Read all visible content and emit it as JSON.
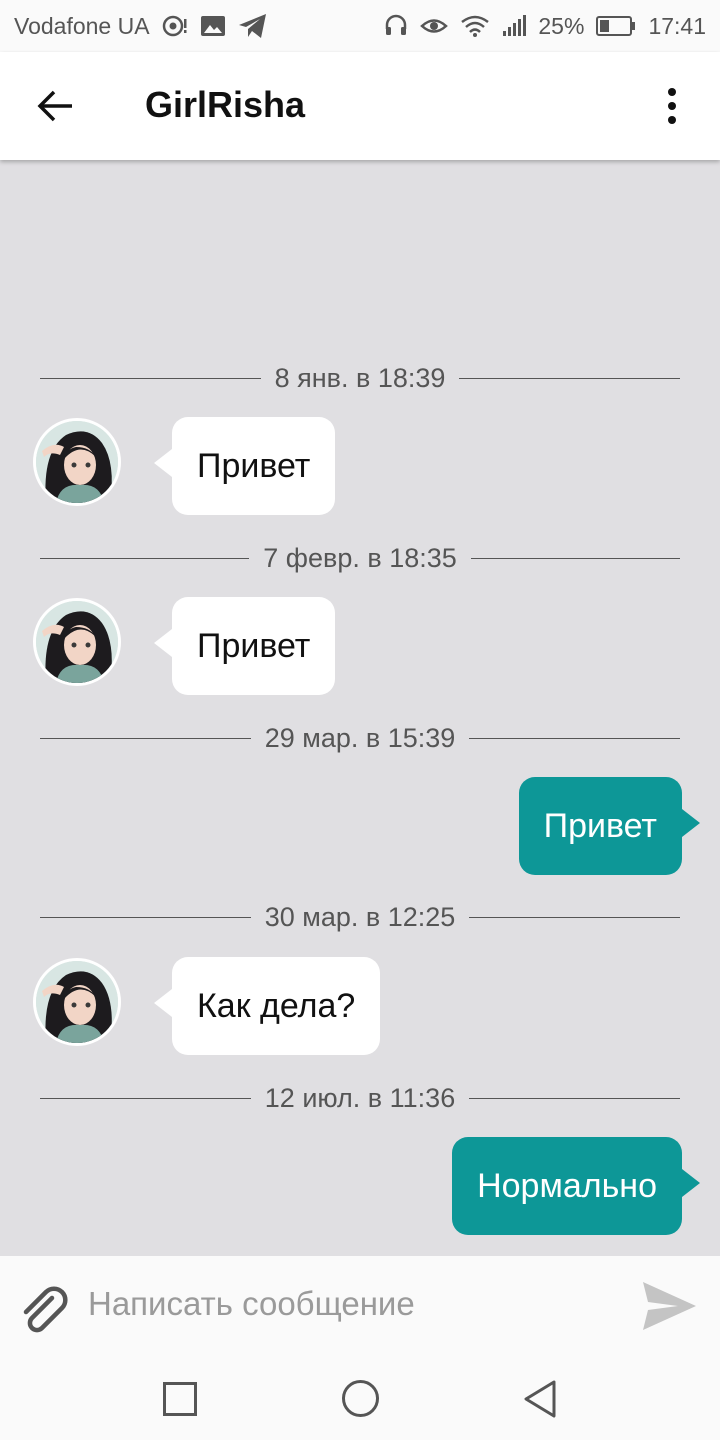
{
  "status_bar": {
    "carrier": "Vodafone UA",
    "battery": "25%",
    "time": "17:41"
  },
  "header": {
    "title": "GirlRisha"
  },
  "messages": [
    {
      "type": "date",
      "text": "8 янв. в 18:39"
    },
    {
      "type": "incoming",
      "text": "Привет"
    },
    {
      "type": "date",
      "text": "7 февр. в 18:35"
    },
    {
      "type": "incoming",
      "text": "Привет"
    },
    {
      "type": "date",
      "text": "29 мар. в 15:39"
    },
    {
      "type": "outgoing",
      "text": "Привет"
    },
    {
      "type": "date",
      "text": "30 мар. в 12:25"
    },
    {
      "type": "incoming",
      "text": "Как дела?"
    },
    {
      "type": "date",
      "text": "12 июл. в 11:36"
    },
    {
      "type": "outgoing",
      "text": "Нормально"
    }
  ],
  "composer": {
    "placeholder": "Написать сообщение"
  },
  "colors": {
    "outgoing_bubble": "#0d9797",
    "chat_background": "#e0dfe2"
  }
}
